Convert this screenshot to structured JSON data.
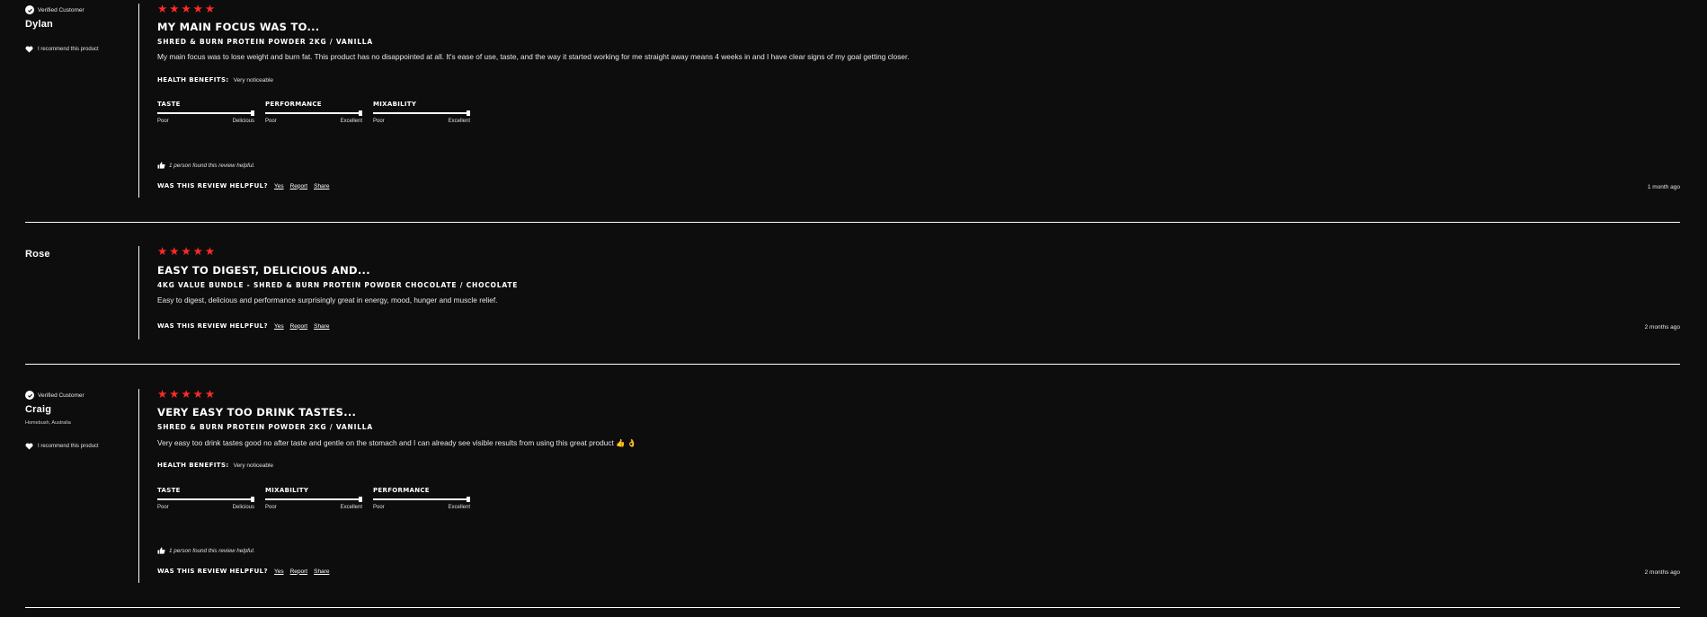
{
  "reviews": [
    {
      "verified_label": "Verified Customer",
      "name": "Dylan",
      "location": "",
      "recommend_label": "I recommend this product",
      "rating": 5,
      "title": "MY MAIN FOCUS WAS TO...",
      "product": "SHRED & BURN PROTEIN POWDER 2KG / VANILLA",
      "body": "My main focus was to lose weight and burn fat. This product has no disappointed at all. It's ease of use, taste, and the way it started working for me straight away means 4 weeks in and I have clear signs of my goal getting closer.",
      "health_label": "HEALTH BENEFITS:",
      "health_value": "Very noticeable",
      "sliders": [
        {
          "label": "TASTE",
          "min": "Poor",
          "max": "Delicious",
          "value": 1.0
        },
        {
          "label": "PERFORMANCE",
          "min": "Poor",
          "max": "Excellent",
          "value": 1.0
        },
        {
          "label": "MIXABILITY",
          "min": "Poor",
          "max": "Excellent",
          "value": 1.0
        }
      ],
      "helpful_count": "1 person found this review helpful.",
      "helpful_question": "WAS THIS REVIEW HELPFUL?",
      "yes": "Yes",
      "report": "Report",
      "share": "Share",
      "time_ago": "1 month ago"
    },
    {
      "name": "Rose",
      "rating": 5,
      "title": "EASY TO DIGEST, DELICIOUS AND...",
      "product": "4KG VALUE BUNDLE - SHRED & BURN PROTEIN POWDER CHOCOLATE / CHOCOLATE",
      "body": "Easy to digest, delicious and performance surprisingly great in energy, mood, hunger and muscle relief.",
      "helpful_question": "WAS THIS REVIEW HELPFUL?",
      "yes": "Yes",
      "report": "Report",
      "share": "Share",
      "time_ago": "2 months ago"
    },
    {
      "verified_label": "Verified Customer",
      "name": "Craig",
      "location": "Homebush, Australia",
      "recommend_label": "I recommend this product",
      "rating": 5,
      "title": "VERY EASY TOO DRINK TASTES...",
      "product": "SHRED & BURN PROTEIN POWDER 2KG / VANILLA",
      "body": "Very easy too drink tastes good no after taste and gentle on the stomach and I can already see visible results from using this great product 👍 👌",
      "health_label": "HEALTH BENEFITS:",
      "health_value": "Very noticeable",
      "sliders": [
        {
          "label": "TASTE",
          "min": "Poor",
          "max": "Delicious",
          "value": 1.0
        },
        {
          "label": "MIXABILITY",
          "min": "Poor",
          "max": "Excellent",
          "value": 1.0
        },
        {
          "label": "PERFORMANCE",
          "min": "Poor",
          "max": "Excellent",
          "value": 1.0
        }
      ],
      "helpful_count": "1 person found this review helpful.",
      "helpful_question": "WAS THIS REVIEW HELPFUL?",
      "yes": "Yes",
      "report": "Report",
      "share": "Share",
      "time_ago": "2 months ago"
    }
  ],
  "colors": {
    "background": "#0d0d0d",
    "star": "#ff2a2a",
    "text": "#ffffff"
  },
  "icons": {
    "verified": "check-circle-icon",
    "recommend": "heart-icon",
    "helpful": "thumbs-up-icon",
    "star": "star-icon"
  }
}
